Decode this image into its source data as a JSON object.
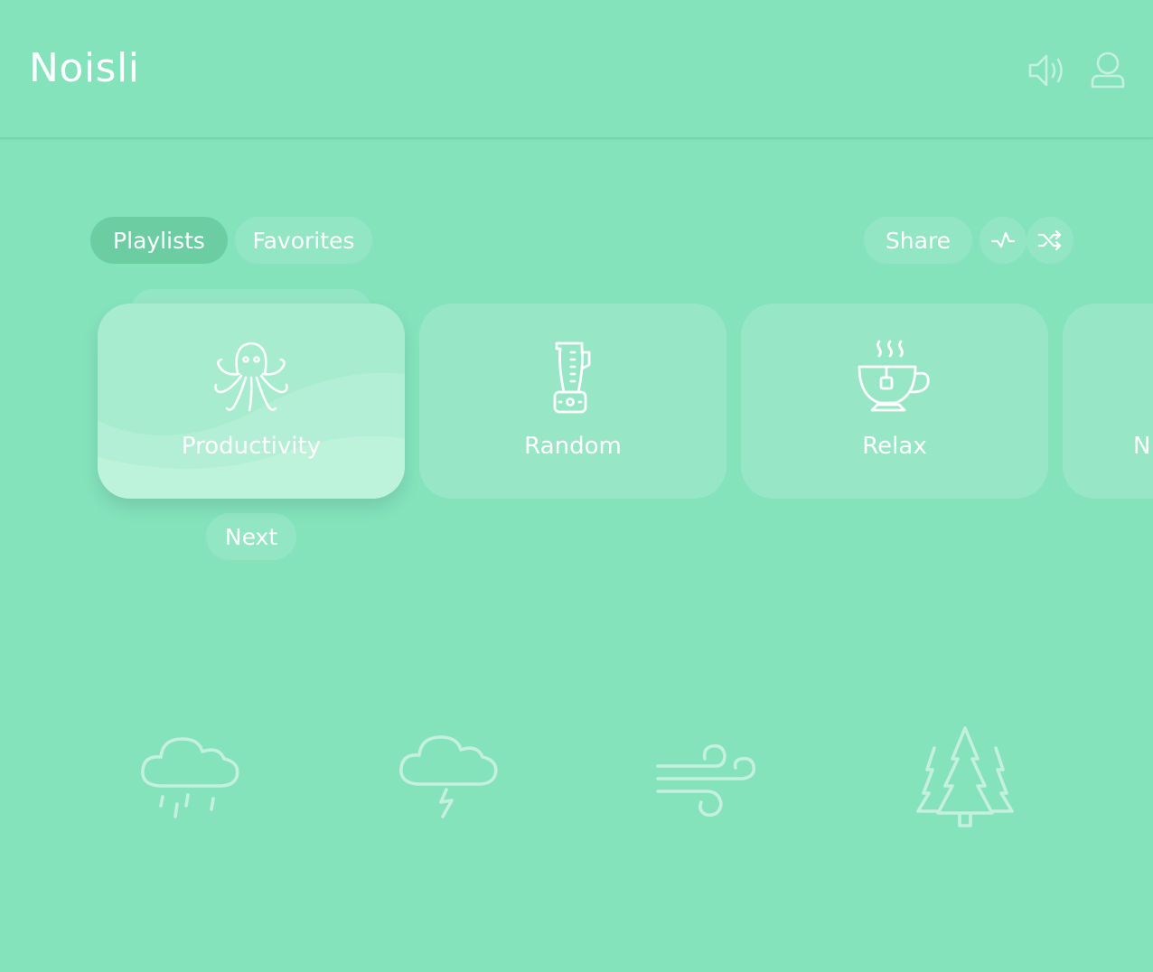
{
  "app": {
    "title": "Noisli"
  },
  "header": {
    "icons": [
      "volume-icon",
      "user-icon"
    ]
  },
  "tabs": [
    {
      "label": "Playlists",
      "selected": true
    },
    {
      "label": "Favorites",
      "selected": false
    }
  ],
  "actions": {
    "share_label": "Share",
    "icons": [
      "pulse-icon",
      "shuffle-icon"
    ]
  },
  "playlists": [
    {
      "label": "Productivity",
      "icon": "octopus-icon",
      "active": true
    },
    {
      "label": "Random",
      "icon": "blender-icon",
      "active": false
    },
    {
      "label": "Relax",
      "icon": "tea-cup-icon",
      "active": false
    },
    {
      "label": "N",
      "icon": "",
      "active": false
    }
  ],
  "next_label": "Next",
  "sounds": [
    {
      "icon": "rain-icon"
    },
    {
      "icon": "thunderstorm-icon"
    },
    {
      "icon": "wind-icon"
    },
    {
      "icon": "forest-icon"
    }
  ],
  "colors": {
    "background": "#84e3bb",
    "accent": "#6ccda2",
    "active_card": "#a8ecd0",
    "text": "#ffffff",
    "sound_icon": "#c4f0dc"
  }
}
